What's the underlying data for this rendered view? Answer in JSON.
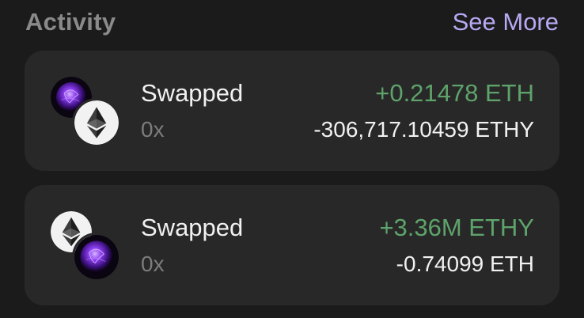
{
  "header": {
    "title": "Activity",
    "see_more_label": "See More"
  },
  "colors": {
    "background": "#1b1b1b",
    "card": "#282828",
    "accent": "#b7a9f2",
    "positive": "#5ea36b"
  },
  "activity": [
    {
      "title": "Swapped",
      "subtitle": "0x",
      "amount_in": "+0.21478 ETH",
      "amount_out": "-306,717.10459 ETHY",
      "back_icon": "purple-orb-token-icon",
      "front_icon": "ethereum-icon"
    },
    {
      "title": "Swapped",
      "subtitle": "0x",
      "amount_in": "+3.36M ETHY",
      "amount_out": "-0.74099 ETH",
      "back_icon": "ethereum-icon",
      "front_icon": "purple-orb-token-icon"
    }
  ]
}
